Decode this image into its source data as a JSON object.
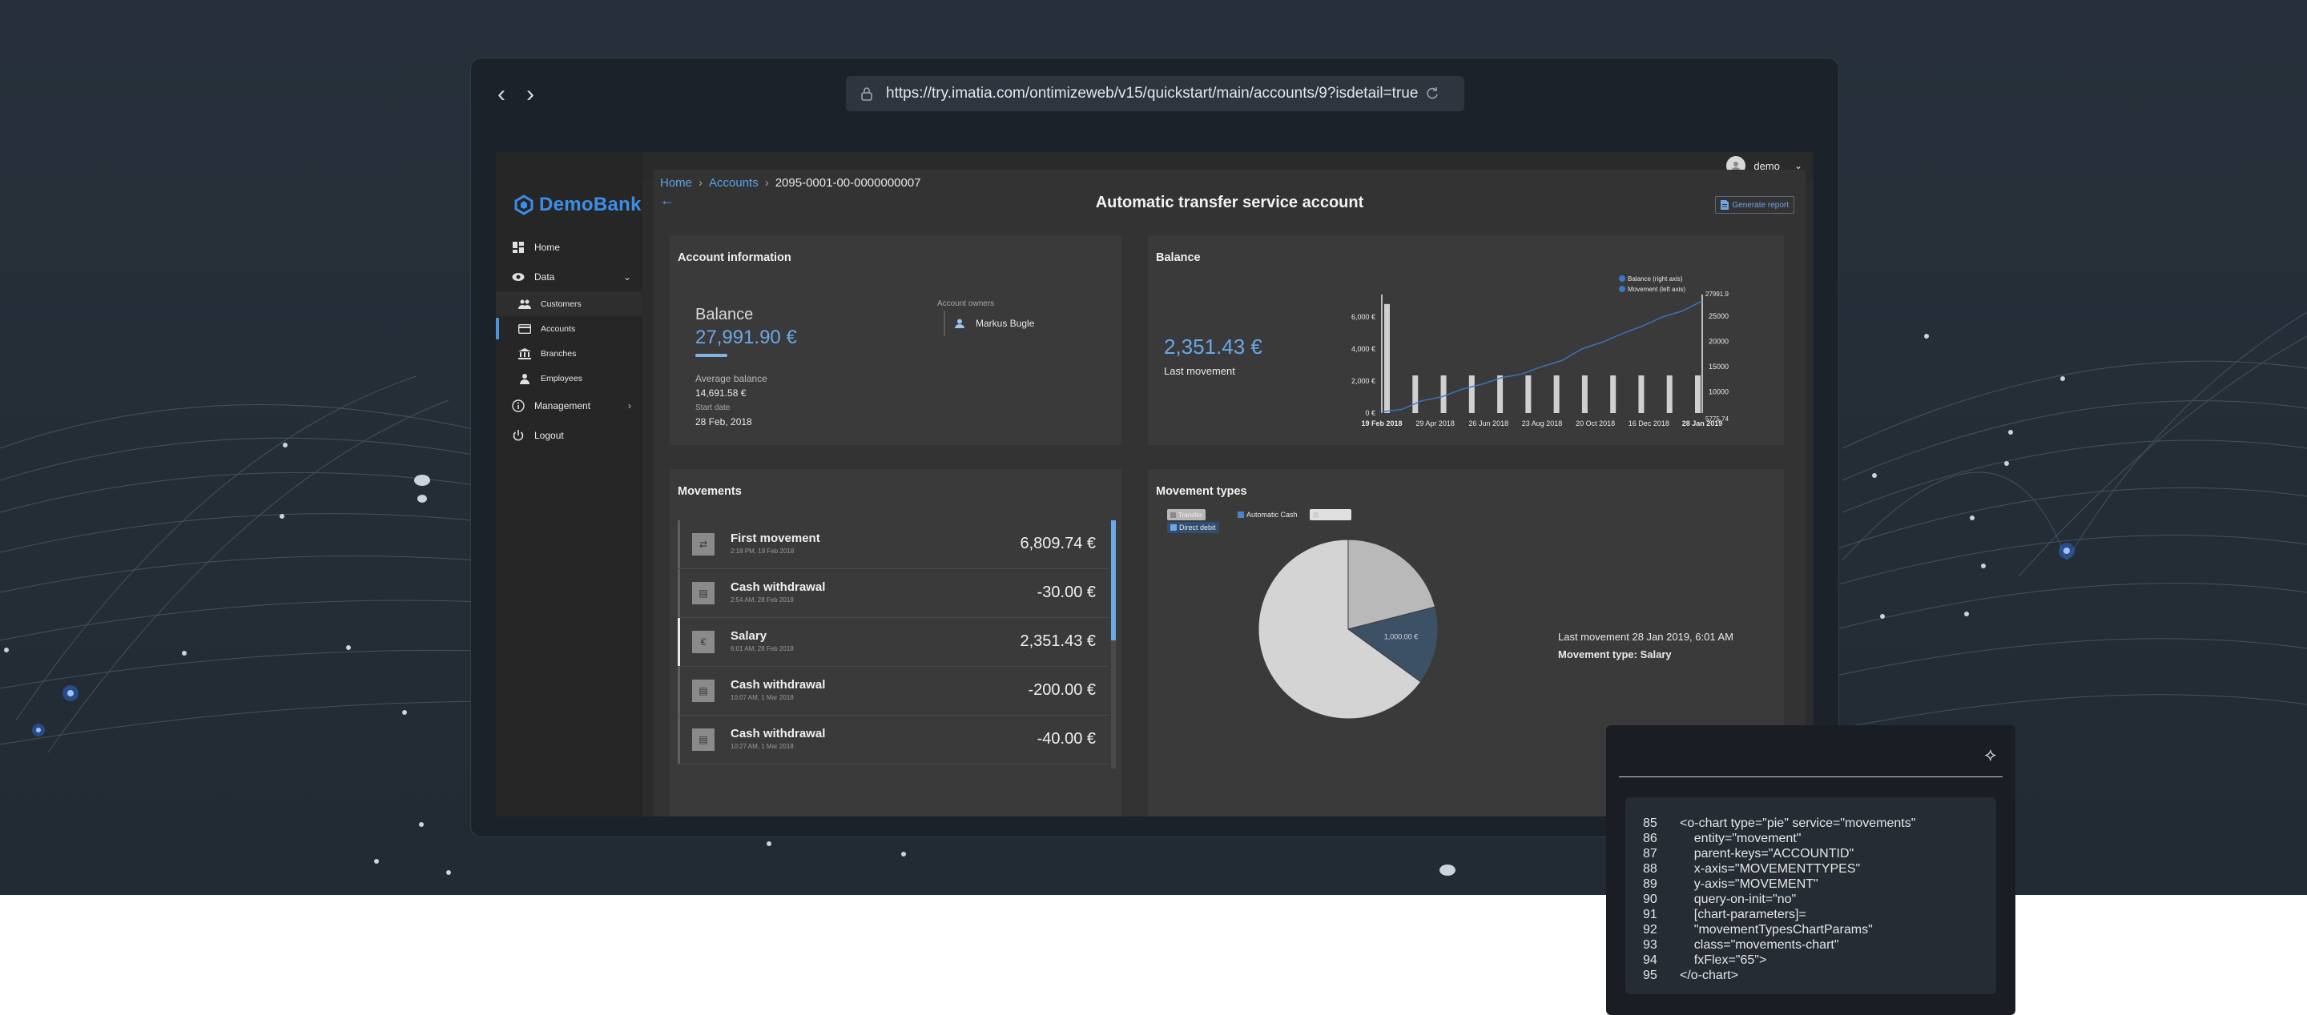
{
  "browser": {
    "url": "https://try.imatia.com/ontimizeweb/v15/quickstart/main/accounts/9?isdetail=true"
  },
  "topbar": {
    "user_name": "demo"
  },
  "sidebar": {
    "logo_text": "DemoBank",
    "items": [
      {
        "label": "Home",
        "icon": "dashboard-icon"
      },
      {
        "label": "Data",
        "icon": "eye-icon"
      },
      {
        "label": "Customers",
        "icon": "people-icon"
      },
      {
        "label": "Accounts",
        "icon": "card-icon"
      },
      {
        "label": "Branches",
        "icon": "bank-icon"
      },
      {
        "label": "Employees",
        "icon": "person-icon"
      },
      {
        "label": "Management",
        "icon": "info-icon"
      },
      {
        "label": "Logout",
        "icon": "power-icon"
      }
    ]
  },
  "breadcrumb": {
    "home": "Home",
    "accounts": "Accounts",
    "current": "2095-0001-00-0000000007"
  },
  "page": {
    "title": "Automatic transfer service account",
    "generate_report": "Generate report"
  },
  "account_info": {
    "title": "Account information",
    "balance_label": "Balance",
    "balance_value": "27,991.90 €",
    "avg_label": "Average balance",
    "avg_value": "14,691.58 €",
    "start_label": "Start date",
    "start_value": "28 Feb, 2018",
    "owners_label": "Account owners",
    "owner_name": "Markus Bugle"
  },
  "balance_card": {
    "title": "Balance",
    "last_value": "2,351.43 €",
    "last_label": "Last movement",
    "legend": [
      "Balance (right axis)",
      "Movement (left axis)"
    ],
    "right_top_label": "27991.9",
    "right_bottom_label": "5775.74"
  },
  "movements": {
    "title": "Movements",
    "items": [
      {
        "name": "First movement",
        "date": "2:18 PM, 19 Feb 2018",
        "amount": "6,809.74 €",
        "icon": "transfer-icon"
      },
      {
        "name": "Cash withdrawal",
        "date": "2:54 AM, 28 Feb 2018",
        "amount": "-30.00 €",
        "icon": "atm-icon"
      },
      {
        "name": "Salary",
        "date": "6:01 AM, 28 Feb 2018",
        "amount": "2,351.43 €",
        "icon": "euro-icon"
      },
      {
        "name": "Cash withdrawal",
        "date": "10:07 AM, 1 Mar 2018",
        "amount": "-200.00 €",
        "icon": "atm-icon"
      },
      {
        "name": "Cash withdrawal",
        "date": "10:27 AM, 1 Mar 2018",
        "amount": "-40.00 €",
        "icon": "atm-icon"
      }
    ]
  },
  "movement_types": {
    "title": "Movement types",
    "legend": [
      "Transfer",
      "Automatic Cash",
      "Salary",
      "Direct debit"
    ],
    "last_movement": "Last movement 28 Jan 2019, 6:01 AM",
    "movement_type": "Movement type: Salary",
    "slice_label": "1,000.00 €"
  },
  "code": {
    "lines": [
      {
        "n": "85",
        "t": "<o-chart type=\"pie\" service=\"movements\""
      },
      {
        "n": "86",
        "t": "    entity=\"movement\""
      },
      {
        "n": "87",
        "t": "    parent-keys=\"ACCOUNTID\""
      },
      {
        "n": "88",
        "t": "    x-axis=\"MOVEMENTTYPES\""
      },
      {
        "n": "89",
        "t": "    y-axis=\"MOVEMENT\""
      },
      {
        "n": "90",
        "t": "    query-on-init=\"no\""
      },
      {
        "n": "91",
        "t": "    [chart-parameters]="
      },
      {
        "n": "92",
        "t": "    \"movementTypesChartParams\""
      },
      {
        "n": "93",
        "t": "    class=\"movements-chart\""
      },
      {
        "n": "94",
        "t": "    fxFlex=\"65\">"
      },
      {
        "n": "95",
        "t": "</o-chart>"
      }
    ]
  },
  "chart_data": [
    {
      "type": "bar",
      "title": "Balance",
      "y_ticks_left": [
        "6,000 €",
        "4,000 €",
        "2,000 €",
        "0 €"
      ],
      "y_ticks_right": [
        "25000",
        "20000",
        "15000",
        "10000"
      ],
      "x_ticks": [
        "19 Feb 2018",
        "29 Apr 2018",
        "26 Jun 2018",
        "23 Aug 2018",
        "20 Oct 2018",
        "16 Dec 2018",
        "28 Jan 2019"
      ],
      "ylim_left": [
        0,
        7000
      ],
      "ylim_right": [
        5775.74,
        27991.9
      ],
      "series": [
        {
          "name": "Movement (left axis)",
          "type": "bar",
          "values": [
            6809.74,
            2351.43,
            2351.43,
            2351.43,
            2351.43,
            2351.43,
            2351.43,
            2351.43,
            2351.43,
            2351.43,
            2351.43,
            2351.43
          ]
        },
        {
          "name": "Balance (right axis)",
          "type": "line",
          "values": [
            6000,
            6500,
            8200,
            9000,
            10500,
            11500,
            12800,
            13500,
            15000,
            16200,
            18500,
            19800,
            21500,
            23000,
            24800,
            26000,
            27991.9
          ]
        }
      ],
      "legend_position": "top-right"
    },
    {
      "type": "pie",
      "title": "Movement types",
      "categories": [
        "Salary",
        "Automatic Cash",
        "Direct debit"
      ],
      "values": [
        65,
        14,
        21
      ],
      "colors": [
        "#d4d4d4",
        "#3d5166",
        "#b9b9b9"
      ]
    }
  ]
}
